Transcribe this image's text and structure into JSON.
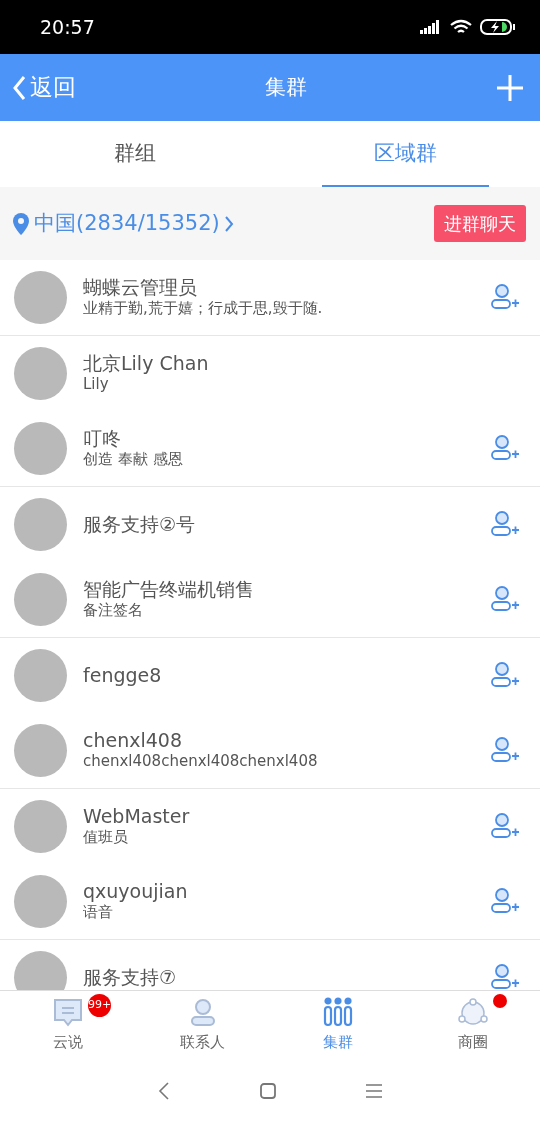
{
  "status_bar": {
    "time": "20:57"
  },
  "header": {
    "back_label": "返回",
    "title": "集群"
  },
  "tabs": [
    {
      "label": "群组",
      "selected": false
    },
    {
      "label": "区域群",
      "selected": true
    }
  ],
  "location": {
    "label": "中国(2834/15352)",
    "button": "进群聊天"
  },
  "contacts": [
    {
      "name": "蝴蝶云管理员",
      "note": "业精于勤,荒于嬉；行成于思,毁于随.",
      "add_button": true,
      "divider_after": true
    },
    {
      "name": "北京Lily Chan",
      "note": "Lily",
      "add_button": false,
      "divider_after": false
    },
    {
      "name": "叮咚",
      "note": "创造 奉献 感恩",
      "add_button": true,
      "divider_after": true
    },
    {
      "name": "服务支持②号",
      "add_button": true,
      "divider_after": false
    },
    {
      "name": "智能广告终端机销售",
      "note": "备注签名",
      "add_button": true,
      "divider_after": true
    },
    {
      "name": "fengge8",
      "add_button": true,
      "divider_after": false
    },
    {
      "name": "chenxl408",
      "note": "chenxl408chenxl408chenxl408",
      "add_button": true,
      "divider_after": true
    },
    {
      "name": "WebMaster",
      "note": "值班员",
      "add_button": true,
      "divider_after": false
    },
    {
      "name": "qxuyoujian",
      "note": "语音",
      "add_button": true,
      "divider_after": true
    },
    {
      "name": "服务支持⑦",
      "add_button": true,
      "divider_after": false
    }
  ],
  "bottom_nav": [
    {
      "kind": "chat",
      "label": "云说",
      "selected": false,
      "badge": "99+"
    },
    {
      "kind": "contacts",
      "label": "联系人",
      "selected": false
    },
    {
      "kind": "cluster",
      "label": "集群",
      "selected": true
    },
    {
      "kind": "circle",
      "label": "商圈",
      "selected": false,
      "dot": true
    }
  ]
}
